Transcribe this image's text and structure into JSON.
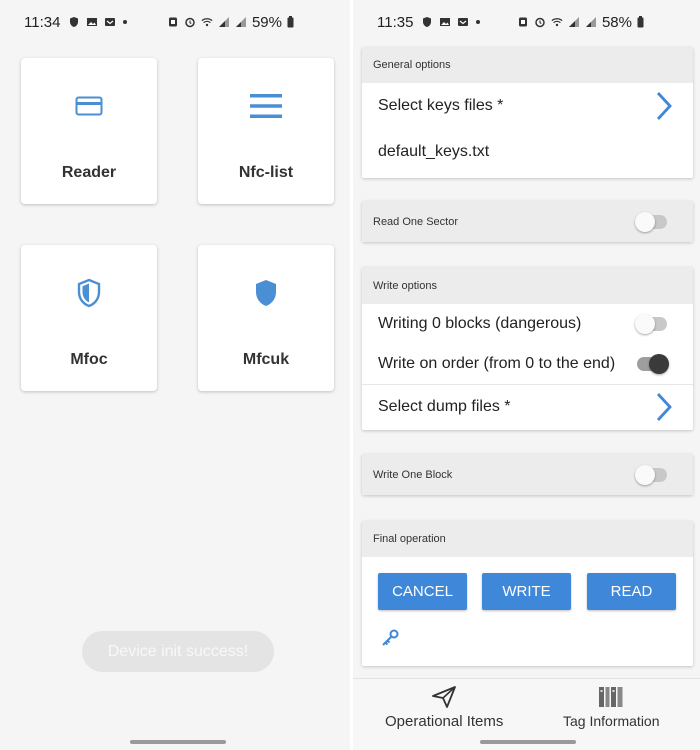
{
  "left_phone": {
    "status": {
      "time": "11:34",
      "battery": "59%"
    },
    "tiles": [
      {
        "label": "Reader",
        "icon": "card-icon"
      },
      {
        "label": "Nfc-list",
        "icon": "menu-icon"
      },
      {
        "label": "Mfoc",
        "icon": "shield-half-icon"
      },
      {
        "label": "Mfcuk",
        "icon": "shield-icon"
      }
    ],
    "toast": "Device init success!"
  },
  "right_phone": {
    "status": {
      "time": "11:35",
      "battery": "58%"
    },
    "general": {
      "header": "General options",
      "select_keys": "Select keys files *",
      "keys_file": "default_keys.txt"
    },
    "read_one": {
      "label": "Read One Sector",
      "on": false
    },
    "write_options": {
      "header": "Write options",
      "writing_zero": {
        "label": "Writing 0 blocks (dangerous)",
        "on": false
      },
      "write_order": {
        "label": "Write on order (from 0 to the end)",
        "on": true
      },
      "select_dump": "Select dump files *"
    },
    "write_one": {
      "label": "Write One Block",
      "on": false
    },
    "final": {
      "header": "Final operation",
      "cancel": "CANCEL",
      "write": "WRITE",
      "read": "READ"
    },
    "nav": {
      "operational": "Operational Items",
      "tag_info": "Tag Information"
    }
  },
  "colors": {
    "accent": "#3f87d9",
    "icon_blue": "#4a8fd4",
    "header_bg": "#ececec"
  }
}
